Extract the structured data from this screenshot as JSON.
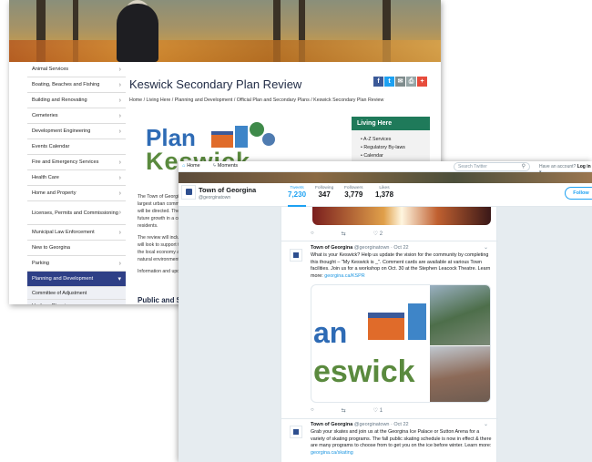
{
  "site": {
    "nav": [
      {
        "label": "Animal Services",
        "chevron": true
      },
      {
        "label": "Boating, Beaches and Fishing",
        "chevron": true
      },
      {
        "label": "Building and Renovating",
        "chevron": true
      },
      {
        "label": "Cemeteries",
        "chevron": true
      },
      {
        "label": "Development Engineering",
        "chevron": true
      },
      {
        "label": "Events Calendar",
        "chevron": false
      },
      {
        "label": "Fire and Emergency Services",
        "chevron": true
      },
      {
        "label": "Health Care",
        "chevron": true
      },
      {
        "label": "Home and Property",
        "chevron": true
      },
      {
        "label": "Licenses, Permits and Commissioning",
        "chevron": true,
        "tall": true
      },
      {
        "label": "Municipal Law Enforcement",
        "chevron": true
      },
      {
        "label": "New to Georgina",
        "chevron": false
      },
      {
        "label": "Parking",
        "chevron": true
      },
      {
        "label": "Planning and Development",
        "chevron": "down",
        "active": true
      }
    ],
    "subnav": [
      "Committee of Adjustment",
      "Heritage Planning"
    ],
    "page_title": "Keswick Secondary Plan Review",
    "breadcrumb": "Home  /  Living Here  /  Planning and Development  /  Official Plan and Secondary Plans  /  Keswick Secondary Plan Review",
    "share_icons": [
      {
        "icon": "facebook-icon",
        "glyph": "f",
        "color": "#3b5998"
      },
      {
        "icon": "twitter-icon",
        "glyph": "t",
        "color": "#1da1f2"
      },
      {
        "icon": "email-icon",
        "glyph": "✉",
        "color": "#7f8c8d"
      },
      {
        "icon": "print-icon",
        "glyph": "⎙",
        "color": "#95a5a6"
      },
      {
        "icon": "plus-icon",
        "glyph": "+",
        "color": "#e74c3c"
      }
    ],
    "logo": {
      "word1": "Plan",
      "word2": "Keswick"
    },
    "living_here": {
      "heading": "Living Here",
      "items": [
        "A-Z Services",
        "Regulatory By-laws",
        "Calendar"
      ]
    },
    "body_lines": [
      "The Town of Georgina",
      "largest urban commun",
      "will be directed. The p",
      "future growth in a coo",
      "residents.",
      "",
      "The review will include",
      "will look to support the",
      "the local economy and",
      "natural environment.",
      "",
      "Information and updat"
    ],
    "section_heading": "Public and Stake"
  },
  "twitter": {
    "nav_home": "Home",
    "nav_moments": "Moments",
    "search_placeholder": "Search Twitter",
    "login_prompt": "Have an account?",
    "login_label": "Log in",
    "profile_name": "Town of Georgina",
    "profile_handle": "@georginatown",
    "stats": [
      {
        "label": "Tweets",
        "value": "7,230",
        "selected": true
      },
      {
        "label": "Following",
        "value": "347"
      },
      {
        "label": "Followers",
        "value": "3,779"
      },
      {
        "label": "Likes",
        "value": "1,378"
      }
    ],
    "follow_label": "Follow",
    "top_actions": {
      "likes": "2"
    },
    "tweets": [
      {
        "name": "Town of Georgina",
        "handle": "@georginatown",
        "date": "Oct 22",
        "text": "What is your Keswick? Help us update the vision for the community by completing this thought – \"My Keswick is _\". Comment cards are available at various Town facilities. Join us for a workshop on Oct. 30 at the Stephen Leacock Theatre. Learn more:",
        "link": "georgina.ca/KSPR",
        "media_text1": "an",
        "media_text2": "eswick",
        "likes": "1"
      },
      {
        "name": "Town of Georgina",
        "handle": "@georginatown",
        "date": "Oct 22",
        "text": "Grab your skates and join us at the Georgina Ice Palace or Sutton Arena for a variety of skating programs. The fall public skating schedule is now in effect & there are many programs to choose from to get you on the ice before winter. Learn more:",
        "link": "georgina.ca/skating"
      }
    ]
  }
}
